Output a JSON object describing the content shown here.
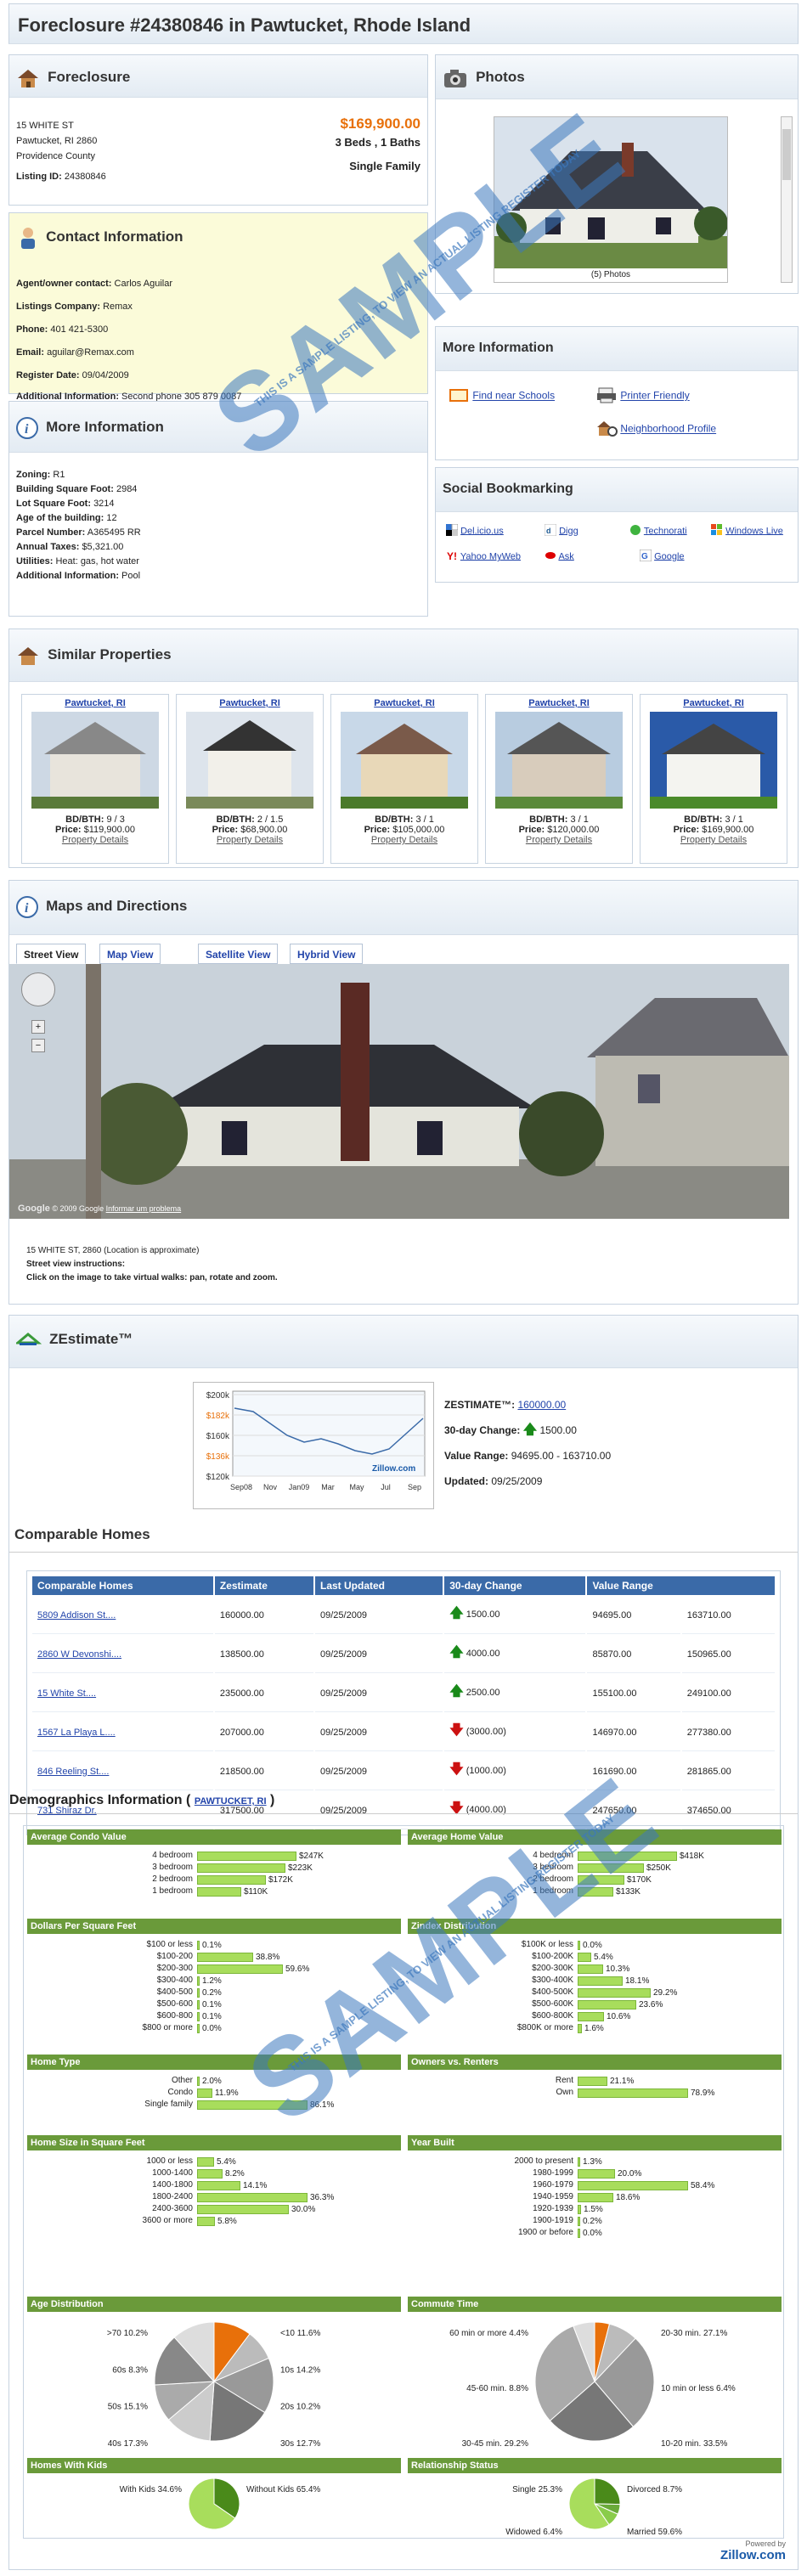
{
  "page": {
    "title": "Foreclosure #24380846 in Pawtucket, Rhode Island"
  },
  "listing": {
    "heading": "Foreclosure",
    "address1": "15 WHITE ST",
    "address2": "Pawtucket, RI 2860",
    "county": "Providence County",
    "listing_id_label": "Listing ID:",
    "listing_id": "24380846",
    "price": "$169,900.00",
    "beds_baths": "3 Beds , 1 Baths",
    "type": "Single Family"
  },
  "contact": {
    "heading": "Contact Information",
    "rows": [
      {
        "k": "Agent/owner contact:",
        "v": "Carlos Aguilar"
      },
      {
        "k": "Listings Company:",
        "v": "Remax"
      },
      {
        "k": "Phone:",
        "v": "401 421-5300"
      },
      {
        "k": "Email:",
        "v": "aguilar@Remax.com"
      },
      {
        "k": "Register Date:",
        "v": "09/04/2009"
      },
      {
        "k": "Additional Information:",
        "v": "Second phone 305 879 0087"
      }
    ]
  },
  "more": {
    "heading": "More Information",
    "rows": [
      {
        "k": "Zoning:",
        "v": "R1"
      },
      {
        "k": "Building Square Foot:",
        "v": "2984"
      },
      {
        "k": "Lot Square Foot:",
        "v": "3214"
      },
      {
        "k": "Age of the building:",
        "v": "12"
      },
      {
        "k": "Parcel Number:",
        "v": "A365495 RR"
      },
      {
        "k": "Annual Taxes:",
        "v": "$5,321.00"
      },
      {
        "k": "Utilities:",
        "v": "Heat: gas, hot water"
      },
      {
        "k": "Additional Information:",
        "v": "Pool"
      }
    ]
  },
  "photos": {
    "heading": "Photos",
    "caption": "(5) Photos"
  },
  "moreinfo": {
    "heading": "More Information",
    "schools": "Find near Schools",
    "printer": "Printer Friendly",
    "neighborhood": "Neighborhood Profile"
  },
  "social": {
    "heading": "Social Bookmarking",
    "items": [
      "Del.icio.us",
      "Digg",
      "Technorati",
      "Windows Live",
      "Yahoo MyWeb",
      "Ask",
      "Google"
    ]
  },
  "similar": {
    "heading": "Similar Properties",
    "bdbth_label": "BD/BTH:",
    "price_label": "Price:",
    "details": "Property Details",
    "items": [
      {
        "city": "Pawtucket, RI",
        "bdbth": "9 / 3",
        "price": "$119,900.00"
      },
      {
        "city": "Pawtucket, RI",
        "bdbth": "2 / 1.5",
        "price": "$68,900.00"
      },
      {
        "city": "Pawtucket, RI",
        "bdbth": "3 / 1",
        "price": "$105,000.00"
      },
      {
        "city": "Pawtucket, RI",
        "bdbth": "3 / 1",
        "price": "$120,000.00"
      },
      {
        "city": "Pawtucket, RI",
        "bdbth": "3 / 1",
        "price": "$169,900.00"
      }
    ]
  },
  "maps": {
    "heading": "Maps and Directions",
    "tabs": [
      "Street View",
      "Map View",
      "Satellite View",
      "Hybrid View"
    ],
    "copyright": "© 2009 Google",
    "problem": "Informar um problema",
    "address_note": "15 WHITE ST, 2860 (Location is approximate)",
    "instr_title": "Street view instructions:",
    "instr": "Click on the image to take virtual walks: pan, rotate and zoom."
  },
  "zestimate": {
    "heading": "ZEstimate™",
    "label": "ZESTIMATE™:",
    "value": "160000.00",
    "change_label": "30-day Change:",
    "change": "1500.00",
    "range_label": "Value Range:",
    "range": "94695.00 - 163710.00",
    "updated_label": "Updated:",
    "updated": "09/25/2009",
    "brand": "Zillow.com"
  },
  "zchart": {
    "y_ticks": [
      "$200k",
      "$182k",
      "$160k",
      "$136k",
      "$120k"
    ],
    "x_ticks": [
      "Sep08",
      "Nov",
      "Jan09",
      "Mar",
      "May",
      "Jul",
      "Sep"
    ]
  },
  "comparable": {
    "heading": "Comparable Homes",
    "columns": [
      "Comparable Homes",
      "Zestimate",
      "Last Updated",
      "30-day Change",
      "Value Range"
    ],
    "rows": [
      {
        "name": "5809 Addison St....",
        "z": "160000.00",
        "u": "09/25/2009",
        "dir": "up",
        "c": "1500.00",
        "r1": "94695.00",
        "r2": "163710.00"
      },
      {
        "name": "2860 W Devonshi....",
        "z": "138500.00",
        "u": "09/25/2009",
        "dir": "up",
        "c": "4000.00",
        "r1": "85870.00",
        "r2": "150965.00"
      },
      {
        "name": "15 White St....",
        "z": "235000.00",
        "u": "09/25/2009",
        "dir": "up",
        "c": "2500.00",
        "r1": "155100.00",
        "r2": "249100.00"
      },
      {
        "name": "1567 La Playa L....",
        "z": "207000.00",
        "u": "09/25/2009",
        "dir": "down",
        "c": "(3000.00)",
        "r1": "146970.00",
        "r2": "277380.00"
      },
      {
        "name": "846 Reeling St....",
        "z": "218500.00",
        "u": "09/25/2009",
        "dir": "down",
        "c": "(1000.00)",
        "r1": "161690.00",
        "r2": "281865.00"
      },
      {
        "name": "731 Shiraz Dr.",
        "z": "317500.00",
        "u": "09/25/2009",
        "dir": "down",
        "c": "(4000.00)",
        "r1": "247650.00",
        "r2": "374650.00"
      }
    ]
  },
  "demo": {
    "heading": "Demographics Information (",
    "heading_end": ")",
    "link": "PAWTUCKET, RI",
    "brand_small": "Powered by",
    "brand": "Zillow.com",
    "condo": {
      "title": "Average Condo Value",
      "rows": [
        {
          "l": "4 bedroom",
          "v": "$247K",
          "f": 0.9
        },
        {
          "l": "3 bedroom",
          "v": "$223K",
          "f": 0.8
        },
        {
          "l": "2 bedroom",
          "v": "$172K",
          "f": 0.62
        },
        {
          "l": "1 bedroom",
          "v": "$110K",
          "f": 0.4
        }
      ]
    },
    "home": {
      "title": "Average Home Value",
      "rows": [
        {
          "l": "4 bedroom",
          "v": "$418K",
          "f": 0.9
        },
        {
          "l": "3 bedroom",
          "v": "$250K",
          "f": 0.6
        },
        {
          "l": "2 bedroom",
          "v": "$170K",
          "f": 0.42
        },
        {
          "l": "1 bedroom",
          "v": "$133K",
          "f": 0.32
        }
      ]
    },
    "ppsf": {
      "title": "Dollars Per Square Feet",
      "rows": [
        {
          "l": "$100 or less",
          "v": "0.1%",
          "f": 0.0
        },
        {
          "l": "$100-200",
          "v": "38.8%",
          "f": 0.51
        },
        {
          "l": "$200-300",
          "v": "59.6%",
          "f": 0.78
        },
        {
          "l": "$300-400",
          "v": "1.2%",
          "f": 0.02
        },
        {
          "l": "$400-500",
          "v": "0.2%",
          "f": 0.0
        },
        {
          "l": "$500-600",
          "v": "0.1%",
          "f": 0.0
        },
        {
          "l": "$600-800",
          "v": "0.1%",
          "f": 0.0
        },
        {
          "l": "$800 or more",
          "v": "0.0%",
          "f": 0.0
        }
      ]
    },
    "zindex": {
      "title": "Zindex Distribution",
      "rows": [
        {
          "l": "$100K or less",
          "v": "0.0%",
          "f": 0.0
        },
        {
          "l": "$100-200K",
          "v": "5.4%",
          "f": 0.12
        },
        {
          "l": "$200-300K",
          "v": "10.3%",
          "f": 0.23
        },
        {
          "l": "$300-400K",
          "v": "18.1%",
          "f": 0.41
        },
        {
          "l": "$400-500K",
          "v": "29.2%",
          "f": 0.66
        },
        {
          "l": "$500-600K",
          "v": "23.6%",
          "f": 0.53
        },
        {
          "l": "$600-800K",
          "v": "10.6%",
          "f": 0.24
        },
        {
          "l": "$800K or more",
          "v": "1.6%",
          "f": 0.04
        }
      ]
    },
    "htype": {
      "title": "Home Type",
      "rows": [
        {
          "l": "Other",
          "v": "2.0%",
          "f": 0.02
        },
        {
          "l": "Condo",
          "v": "11.9%",
          "f": 0.14
        },
        {
          "l": "Single family",
          "v": "86.1%",
          "f": 1.0
        }
      ]
    },
    "owners": {
      "title": "Owners vs. Renters",
      "rows": [
        {
          "l": "Rent",
          "v": "21.1%",
          "f": 0.27
        },
        {
          "l": "Own",
          "v": "78.9%",
          "f": 1.0
        }
      ]
    },
    "hsize": {
      "title": "Home Size in Square Feet",
      "rows": [
        {
          "l": "1000 or less",
          "v": "5.4%",
          "f": 0.15
        },
        {
          "l": "1000-1400",
          "v": "8.2%",
          "f": 0.23
        },
        {
          "l": "1400-1800",
          "v": "14.1%",
          "f": 0.39
        },
        {
          "l": "1800-2400",
          "v": "36.3%",
          "f": 1.0
        },
        {
          "l": "2400-3600",
          "v": "30.0%",
          "f": 0.83
        },
        {
          "l": "3600 or more",
          "v": "5.8%",
          "f": 0.16
        }
      ]
    },
    "built": {
      "title": "Year Built",
      "rows": [
        {
          "l": "2000 to present",
          "v": "1.3%",
          "f": 0.02
        },
        {
          "l": "1980-1999",
          "v": "20.0%",
          "f": 0.34
        },
        {
          "l": "1960-1979",
          "v": "58.4%",
          "f": 1.0
        },
        {
          "l": "1940-1959",
          "v": "18.6%",
          "f": 0.32
        },
        {
          "l": "1920-1939",
          "v": "1.5%",
          "f": 0.03
        },
        {
          "l": "1900-1919",
          "v": "0.2%",
          "f": 0.0
        },
        {
          "l": "1900 or before",
          "v": "0.0%",
          "f": 0.0
        }
      ]
    },
    "age": {
      "title": "Age Distribution",
      "labels": [
        ">70 10.2%",
        "60s 8.3%",
        "50s 15.1%",
        "40s 17.3%",
        "<10 11.6%",
        "10s 14.2%",
        "20s 10.2%",
        "30s 12.7%"
      ]
    },
    "commute": {
      "title": "Commute Time",
      "labels": [
        "60 min or more 4.4%",
        "45-60 min. 8.8%",
        "30-45 min. 29.2%",
        "20-30 min. 27.1%",
        "10 min or less 6.4%",
        "10-20 min. 33.5%"
      ]
    },
    "kids": {
      "title": "Homes With Kids",
      "labels": [
        "With Kids 34.6%",
        "Without Kids 65.4%"
      ]
    },
    "rel": {
      "title": "Relationship Status",
      "labels": [
        "Single 25.3%",
        "Widowed 6.4%",
        "Divorced 8.7%",
        "Married 59.6%"
      ]
    }
  },
  "watermark": {
    "big": "SAMPLE",
    "small": "THIS IS A SAMPLE LISTING, TO VIEW AN ACTUAL LISTING REGISTER TODAY"
  }
}
